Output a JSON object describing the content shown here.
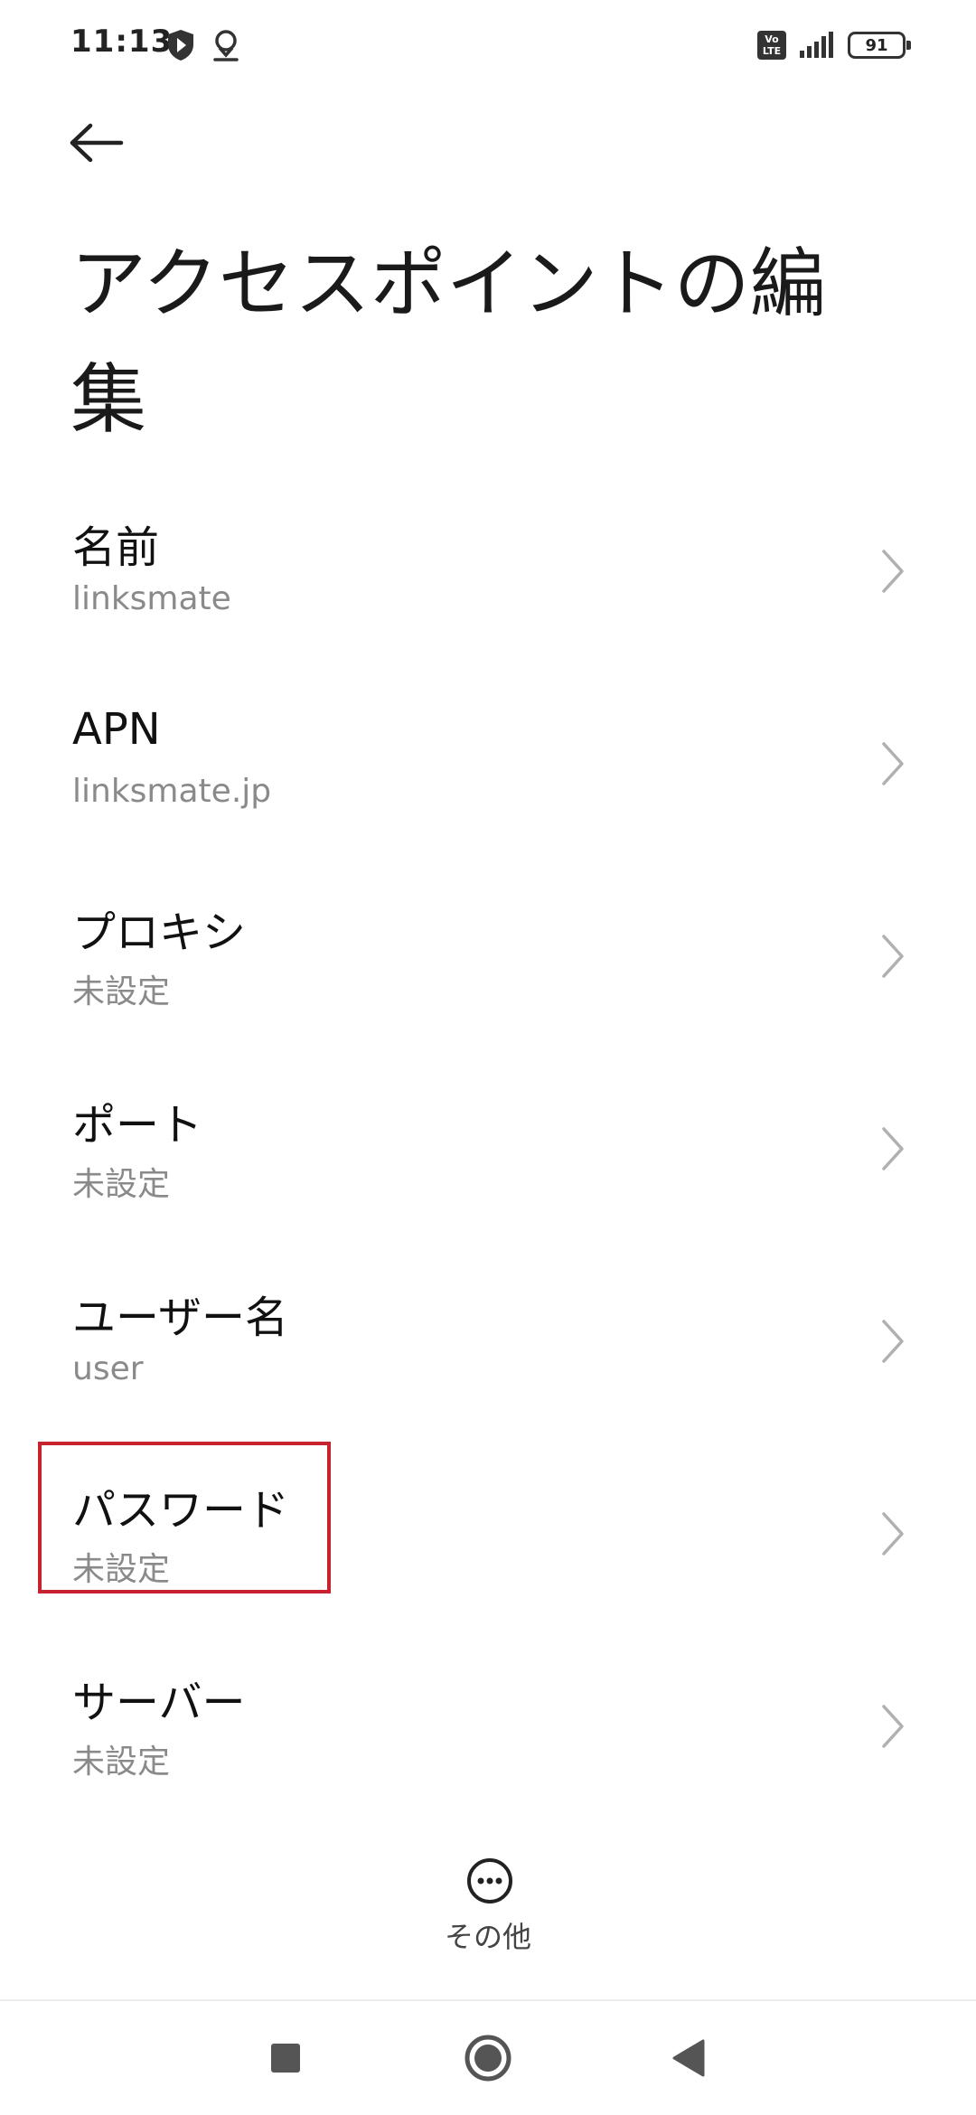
{
  "status_bar": {
    "time": "11:13",
    "network_badge_top": "Vo",
    "network_badge_bottom": "LTE",
    "battery_level": "91"
  },
  "header": {
    "title": "アクセスポイントの編集"
  },
  "settings": {
    "items": [
      {
        "label": "名前",
        "value": "linksmate"
      },
      {
        "label": "APN",
        "value": "linksmate.jp"
      },
      {
        "label": "プロキシ",
        "value": "未設定"
      },
      {
        "label": "ポート",
        "value": "未設定"
      },
      {
        "label": "ユーザー名",
        "value": "user"
      },
      {
        "label": "パスワード",
        "value": "未設定"
      },
      {
        "label": "サーバー",
        "value": "未設定"
      }
    ]
  },
  "more": {
    "label": "その他"
  },
  "colors": {
    "highlight": "#c8222e",
    "secondary_text": "#8a8a8a",
    "chevron": "#b0b0b0"
  }
}
